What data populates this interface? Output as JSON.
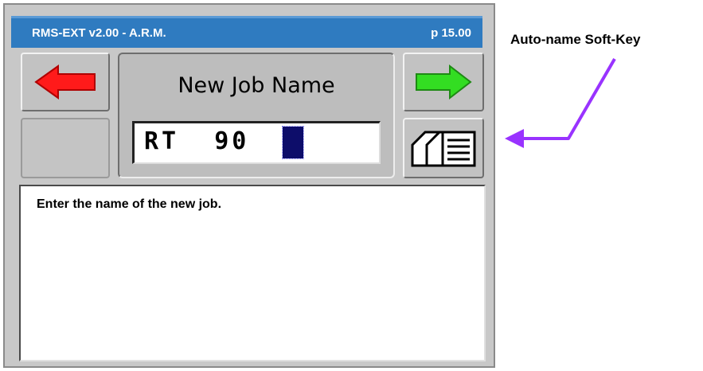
{
  "titlebar": {
    "title": "RMS-EXT v2.00 - A.R.M.",
    "page": "p 15.00"
  },
  "softkeys": {
    "back": "left-arrow-icon",
    "next": "right-arrow-icon",
    "autoname": "stacked-pages-icon"
  },
  "dialog": {
    "heading": "New Job Name",
    "field_value": "RT  90"
  },
  "message": {
    "text": "Enter the name of the new job."
  },
  "annotation": {
    "label": "Auto-name Soft-Key"
  },
  "colors": {
    "titlebar": "#2f7bc0",
    "back_arrow": "#ff1a1a",
    "next_arrow": "#33dd22",
    "cursor": "#0d0d6a",
    "annotation_arrow": "#9933ff"
  }
}
